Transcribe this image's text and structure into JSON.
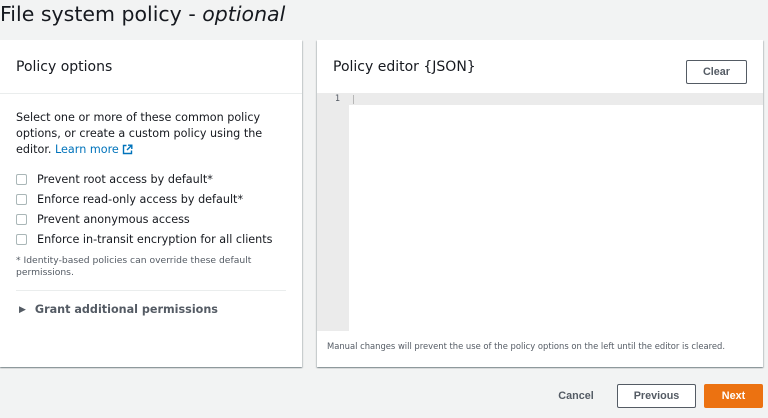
{
  "page": {
    "title": "File system policy - ",
    "title_optional": "optional"
  },
  "policy_options": {
    "heading": "Policy options",
    "description": "Select one or more of these common policy options, or create a custom policy using the editor. ",
    "learn_more": "Learn more",
    "options": [
      {
        "label": "Prevent root access by default*",
        "checked": false
      },
      {
        "label": "Enforce read-only access by default*",
        "checked": false
      },
      {
        "label": "Prevent anonymous access",
        "checked": false
      },
      {
        "label": "Enforce in-transit encryption for all clients",
        "checked": false
      }
    ],
    "footnote": "* Identity-based policies can override these default permissions.",
    "expander_label": "Grant additional permissions",
    "external_link_icon": "external-link-icon"
  },
  "editor": {
    "heading": "Policy editor {JSON}",
    "clear_label": "Clear",
    "line_number": "1",
    "content": "",
    "helper_text": "Manual changes will prevent the use of the policy options on the left until the editor is cleared."
  },
  "footer": {
    "cancel_label": "Cancel",
    "previous_label": "Previous",
    "next_label": "Next"
  },
  "colors": {
    "link": "#0073bb",
    "primary_button": "#ec7211",
    "background": "#f2f3f3",
    "gutter": "#ebebeb"
  }
}
